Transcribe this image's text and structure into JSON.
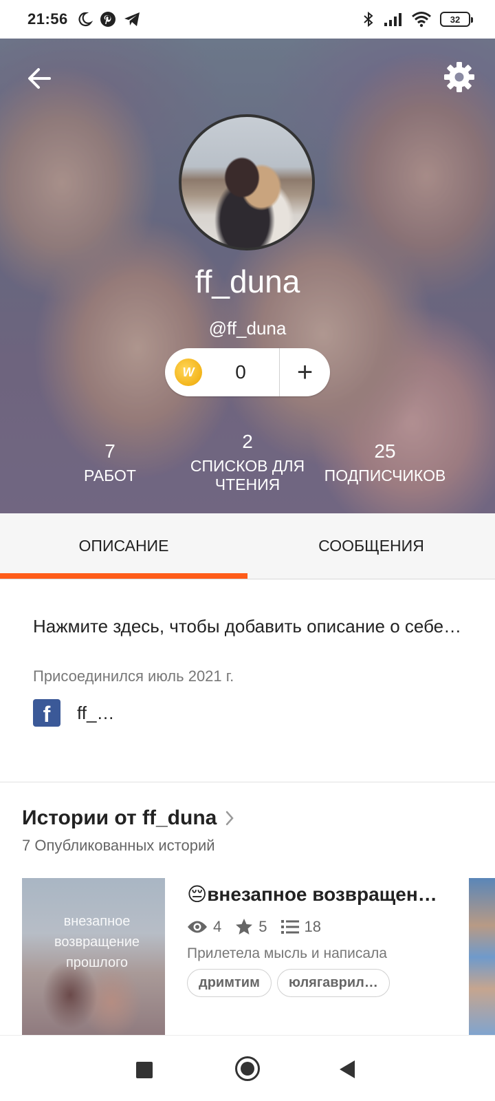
{
  "status_bar": {
    "time": "21:56",
    "left_icons": [
      "moon-icon",
      "pinterest-icon",
      "telegram-icon"
    ],
    "right_icons": [
      "bluetooth-icon",
      "signal-icon",
      "wifi-icon",
      "battery-icon"
    ],
    "battery": "32"
  },
  "profile": {
    "display_name": "ff_duna",
    "handle": "@ff_duna",
    "coins": "0",
    "add_coins": "+",
    "coin_letter": "W"
  },
  "stats": {
    "works_count": "7",
    "works_label": "РАБОТ",
    "lists_count": "2",
    "lists_label": "СПИСКОВ ДЛЯ ЧТЕНИЯ",
    "followers_count": "25",
    "followers_label": "ПОДПИСЧИКОВ"
  },
  "tabs": {
    "about": "ОПИСАНИЕ",
    "messages": "СООБЩЕНИЯ"
  },
  "about": {
    "description_placeholder": "Нажмите здесь, чтобы добавить описание о себе…",
    "joined": "Присоединился июль 2021 г.",
    "facebook_letter": "f",
    "facebook_name": "ff_…"
  },
  "stories": {
    "title": "Истории от ff_duna",
    "subtitle": "7 Опубликованных историй",
    "items": [
      {
        "cover_text": "внезапное возвращение прошлого",
        "title": "😔внезапное возвращение прошлог…",
        "reads": "4",
        "votes": "5",
        "parts": "18",
        "blurb": "Прилетела мысль и написала",
        "tags": [
          "дримтим",
          "юлягаврил…"
        ]
      }
    ]
  },
  "colors": {
    "accent": "#ff5c19",
    "facebook": "#3b5998",
    "coin": "#f3b51b"
  }
}
